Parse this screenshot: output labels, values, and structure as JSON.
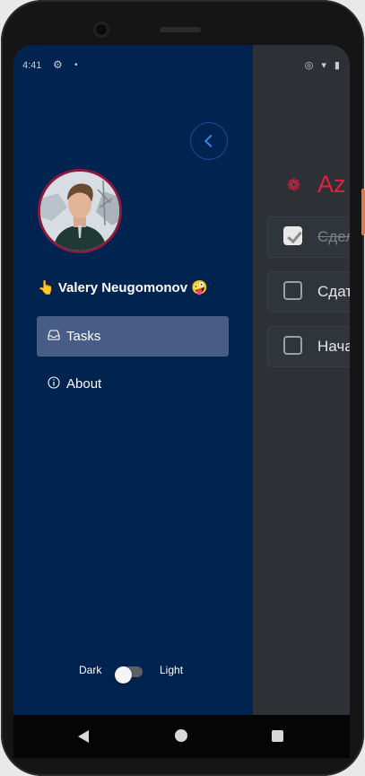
{
  "status_bar": {
    "time": "4:41",
    "right_icons": "◎ ▾ ▮"
  },
  "app": {
    "title": "Az",
    "tasks": [
      {
        "text": "Сдела",
        "done": true
      },
      {
        "text": "Сдать",
        "done": false
      },
      {
        "text": "Начат",
        "done": false
      }
    ]
  },
  "drawer": {
    "user_name": "👆 Valery Neugomonov 🤪",
    "nav": [
      {
        "label": "Tasks",
        "icon": "inbox-icon",
        "active": true
      },
      {
        "label": "About",
        "icon": "info-icon",
        "active": false
      }
    ],
    "theme": {
      "dark_label": "Dark",
      "light_label": "Light",
      "value": "dark"
    }
  },
  "colors": {
    "drawer_bg": "#002350",
    "active_item": "#475d85",
    "accent_red": "#e0223f",
    "app_bg": "#2d3136"
  }
}
